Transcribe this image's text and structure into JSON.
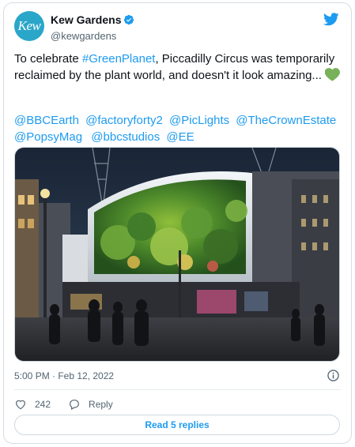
{
  "account": {
    "display_name": "Kew Gardens",
    "handle": "@kewgardens",
    "avatar_text": "Kew",
    "verified_icon": "verified-badge-icon",
    "brand_icon": "twitter-bird-icon"
  },
  "tweet": {
    "text_before": "To celebrate ",
    "hashtag": "#GreenPlanet",
    "text_after": ", Piccadilly Circus was temporarily reclaimed by the plant world, and doesn't it look amazing...",
    "emoji": "green-heart-icon",
    "mentions": [
      "@BBCEarth",
      "@factoryforty2",
      "@PicLights",
      "@TheCrownEstate",
      "@PopsyMag",
      "@bbcstudios",
      "@EE"
    ],
    "photo": "piccadilly-circus-plant-billboard"
  },
  "meta": {
    "timestamp": "5:00 PM · Feb 12, 2022",
    "info_icon": "info-icon"
  },
  "actions": {
    "like_count": "242",
    "reply_label": "Reply"
  },
  "read_replies_label": "Read 5 replies",
  "colors": {
    "accent": "#1d9bf0",
    "avatar": "#2aa6c9",
    "heart": "#78b159",
    "text": "#0f1419",
    "muted": "#536471"
  }
}
